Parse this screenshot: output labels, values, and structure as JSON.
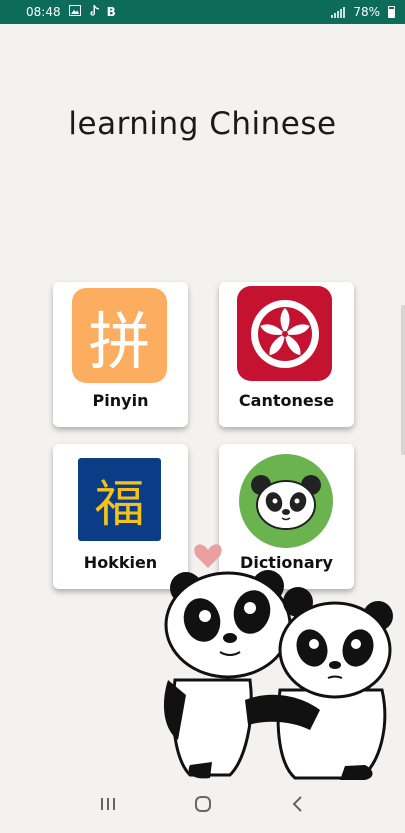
{
  "status_bar": {
    "time": "08:48",
    "left_icons": [
      "image-icon",
      "tiktok-icon",
      "b-icon"
    ],
    "b_label": "B",
    "battery": "78%",
    "color": "#0d6b59"
  },
  "title": "learning Chinese",
  "cards": [
    {
      "label": "Pinyin",
      "icon": "pinyin-icon",
      "glyph": "拼",
      "color": "#fcad60"
    },
    {
      "label": "Cantonese",
      "icon": "hong-kong-flag-icon",
      "color": "#c41230"
    },
    {
      "label": "Hokkien",
      "icon": "fu-icon",
      "glyph": "福",
      "color": "#0b3d86"
    },
    {
      "label": "Dictionary",
      "icon": "panda-icon",
      "color": "#6bb34f"
    }
  ],
  "nav": {
    "recents": "recents-icon",
    "home": "home-icon",
    "back": "back-icon"
  }
}
